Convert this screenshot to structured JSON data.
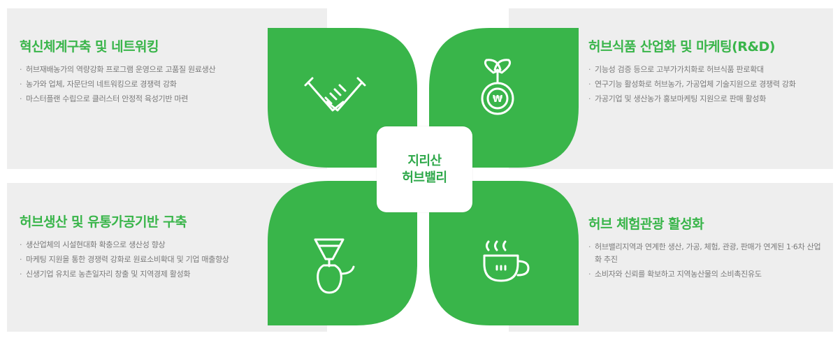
{
  "center": {
    "line1": "지리산",
    "line2": "허브밸리"
  },
  "quadrants": {
    "top_left": {
      "title": "혁신체계구축 및 네트워킹",
      "icon": "handshake-icon",
      "items": [
        "허브재배농가의 역량강화 프로그램 운영으로 고품질 원료생산",
        "농가와 업체, 자문단의 네트워킹으로 경쟁력 강화",
        "마스터플랜 수립으로 클러스터 안정적 육성기반 마련"
      ]
    },
    "top_right": {
      "title": "허브식품 산업화 및 마케팅(R&D)",
      "icon": "sprout-coin-icon",
      "items": [
        "기능성 검증 등으로 고부가가치화로 허브식품 판로확대",
        "연구기능 활성화로 허브농가, 가공업체 기술지원으로 경쟁력 강화",
        "가공기업 및 생산농가 홍보마케팅 지원으로 판매 활성화"
      ]
    },
    "bottom_left": {
      "title": "허브생산 및 유통가공기반 구축",
      "icon": "coffee-dripper-icon",
      "items": [
        "생산업체의 시설현대화 확충으로 생산성 향상",
        "마케팅 지원을 통한 경쟁력 강화로 원료소비확대 및 기업 매출향상",
        "신생기업 유치로 농촌일자리 창출 및 지역경제 활성화"
      ]
    },
    "bottom_right": {
      "title": "허브 체험관광 활성화",
      "icon": "tea-cup-icon",
      "items": [
        "허브밸리지역과 연계한 생산, 가공, 체험, 관광, 판매가 연계된 1·6차 산업화 추진",
        "소비자와 신뢰를 확보하고 지역농산물의 소비촉진유도"
      ]
    }
  },
  "colors": {
    "green": "#39b54a",
    "text_gray": "#7a7a7a",
    "panel_bg": "#eeeeee"
  }
}
